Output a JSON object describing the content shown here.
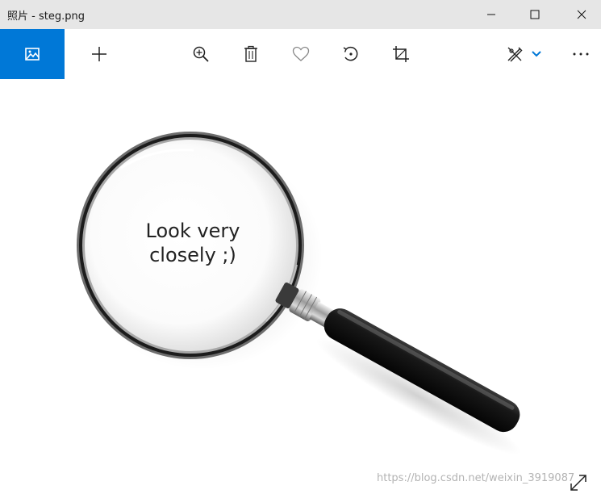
{
  "window": {
    "title": "照片 - steg.png",
    "minimize_icon": "minimize-icon",
    "maximize_icon": "maximize-icon",
    "close_icon": "close-icon"
  },
  "toolbar": {
    "accent_color": "#0078d7",
    "buttons": [
      {
        "icon": "collection-icon"
      },
      {
        "icon": "add-icon"
      },
      {
        "icon": "zoom-in-icon"
      },
      {
        "icon": "delete-icon"
      },
      {
        "icon": "favorite-icon"
      },
      {
        "icon": "rotate-icon"
      },
      {
        "icon": "crop-icon"
      },
      {
        "icon": "edit-create-icon"
      },
      {
        "icon": "chevron-down-icon"
      },
      {
        "icon": "more-icon"
      }
    ]
  },
  "image": {
    "text_line1": "Look very",
    "text_line2": "closely ;)",
    "watermark": "https://blog.csdn.net/weixin_3919087"
  },
  "canvas": {
    "expand_icon": "expand-icon"
  }
}
